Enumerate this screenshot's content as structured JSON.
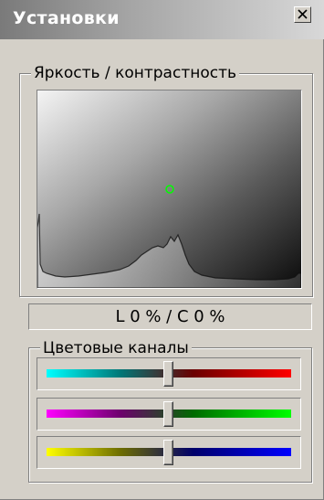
{
  "window": {
    "title": "Установки",
    "close_icon": "close-x-icon"
  },
  "brightness_contrast": {
    "label": "Яркость / контрастность",
    "brightness_percent": 0,
    "contrast_percent": 0,
    "readout": "L 0 % / C 0 %"
  },
  "color_channels": {
    "label": "Цветовые каналы",
    "sliders": [
      {
        "name": "cyan-red",
        "left_color": "#00ffff",
        "right_color": "#ff0000",
        "value": 0
      },
      {
        "name": "magenta-green",
        "left_color": "#ff00ff",
        "right_color": "#00ff00",
        "value": 0
      },
      {
        "name": "yellow-blue",
        "left_color": "#ffff00",
        "right_color": "#0000ff",
        "value": 0
      }
    ]
  },
  "colors": {
    "panel_bg": "#d4d0c8",
    "marker": "#00ff00"
  }
}
